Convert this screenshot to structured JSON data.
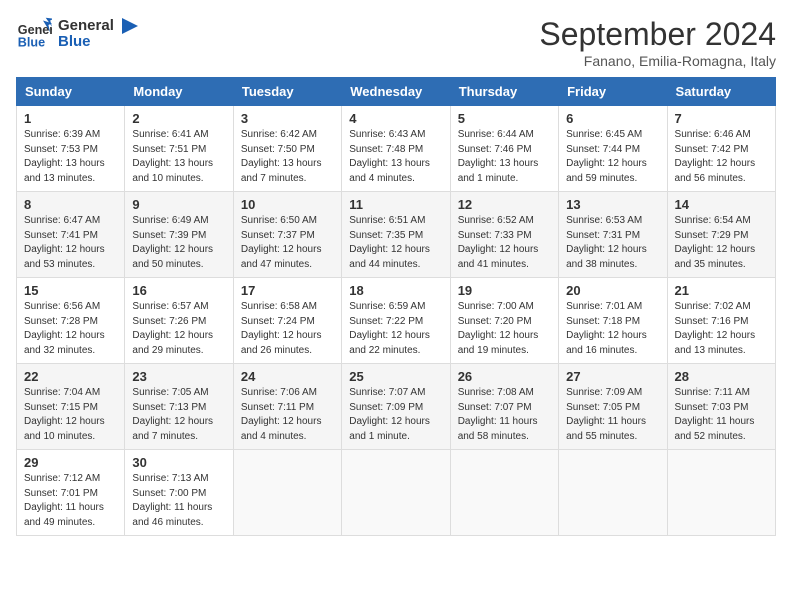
{
  "header": {
    "logo_line1": "General",
    "logo_line2": "Blue",
    "month": "September 2024",
    "location": "Fanano, Emilia-Romagna, Italy"
  },
  "days_of_week": [
    "Sunday",
    "Monday",
    "Tuesday",
    "Wednesday",
    "Thursday",
    "Friday",
    "Saturday"
  ],
  "weeks": [
    [
      {
        "day": "1",
        "sunrise": "6:39 AM",
        "sunset": "7:53 PM",
        "daylight": "13 hours and 13 minutes."
      },
      {
        "day": "2",
        "sunrise": "6:41 AM",
        "sunset": "7:51 PM",
        "daylight": "13 hours and 10 minutes."
      },
      {
        "day": "3",
        "sunrise": "6:42 AM",
        "sunset": "7:50 PM",
        "daylight": "13 hours and 7 minutes."
      },
      {
        "day": "4",
        "sunrise": "6:43 AM",
        "sunset": "7:48 PM",
        "daylight": "13 hours and 4 minutes."
      },
      {
        "day": "5",
        "sunrise": "6:44 AM",
        "sunset": "7:46 PM",
        "daylight": "13 hours and 1 minute."
      },
      {
        "day": "6",
        "sunrise": "6:45 AM",
        "sunset": "7:44 PM",
        "daylight": "12 hours and 59 minutes."
      },
      {
        "day": "7",
        "sunrise": "6:46 AM",
        "sunset": "7:42 PM",
        "daylight": "12 hours and 56 minutes."
      }
    ],
    [
      {
        "day": "8",
        "sunrise": "6:47 AM",
        "sunset": "7:41 PM",
        "daylight": "12 hours and 53 minutes."
      },
      {
        "day": "9",
        "sunrise": "6:49 AM",
        "sunset": "7:39 PM",
        "daylight": "12 hours and 50 minutes."
      },
      {
        "day": "10",
        "sunrise": "6:50 AM",
        "sunset": "7:37 PM",
        "daylight": "12 hours and 47 minutes."
      },
      {
        "day": "11",
        "sunrise": "6:51 AM",
        "sunset": "7:35 PM",
        "daylight": "12 hours and 44 minutes."
      },
      {
        "day": "12",
        "sunrise": "6:52 AM",
        "sunset": "7:33 PM",
        "daylight": "12 hours and 41 minutes."
      },
      {
        "day": "13",
        "sunrise": "6:53 AM",
        "sunset": "7:31 PM",
        "daylight": "12 hours and 38 minutes."
      },
      {
        "day": "14",
        "sunrise": "6:54 AM",
        "sunset": "7:29 PM",
        "daylight": "12 hours and 35 minutes."
      }
    ],
    [
      {
        "day": "15",
        "sunrise": "6:56 AM",
        "sunset": "7:28 PM",
        "daylight": "12 hours and 32 minutes."
      },
      {
        "day": "16",
        "sunrise": "6:57 AM",
        "sunset": "7:26 PM",
        "daylight": "12 hours and 29 minutes."
      },
      {
        "day": "17",
        "sunrise": "6:58 AM",
        "sunset": "7:24 PM",
        "daylight": "12 hours and 26 minutes."
      },
      {
        "day": "18",
        "sunrise": "6:59 AM",
        "sunset": "7:22 PM",
        "daylight": "12 hours and 22 minutes."
      },
      {
        "day": "19",
        "sunrise": "7:00 AM",
        "sunset": "7:20 PM",
        "daylight": "12 hours and 19 minutes."
      },
      {
        "day": "20",
        "sunrise": "7:01 AM",
        "sunset": "7:18 PM",
        "daylight": "12 hours and 16 minutes."
      },
      {
        "day": "21",
        "sunrise": "7:02 AM",
        "sunset": "7:16 PM",
        "daylight": "12 hours and 13 minutes."
      }
    ],
    [
      {
        "day": "22",
        "sunrise": "7:04 AM",
        "sunset": "7:15 PM",
        "daylight": "12 hours and 10 minutes."
      },
      {
        "day": "23",
        "sunrise": "7:05 AM",
        "sunset": "7:13 PM",
        "daylight": "12 hours and 7 minutes."
      },
      {
        "day": "24",
        "sunrise": "7:06 AM",
        "sunset": "7:11 PM",
        "daylight": "12 hours and 4 minutes."
      },
      {
        "day": "25",
        "sunrise": "7:07 AM",
        "sunset": "7:09 PM",
        "daylight": "12 hours and 1 minute."
      },
      {
        "day": "26",
        "sunrise": "7:08 AM",
        "sunset": "7:07 PM",
        "daylight": "11 hours and 58 minutes."
      },
      {
        "day": "27",
        "sunrise": "7:09 AM",
        "sunset": "7:05 PM",
        "daylight": "11 hours and 55 minutes."
      },
      {
        "day": "28",
        "sunrise": "7:11 AM",
        "sunset": "7:03 PM",
        "daylight": "11 hours and 52 minutes."
      }
    ],
    [
      {
        "day": "29",
        "sunrise": "7:12 AM",
        "sunset": "7:01 PM",
        "daylight": "11 hours and 49 minutes."
      },
      {
        "day": "30",
        "sunrise": "7:13 AM",
        "sunset": "7:00 PM",
        "daylight": "11 hours and 46 minutes."
      },
      null,
      null,
      null,
      null,
      null
    ]
  ]
}
